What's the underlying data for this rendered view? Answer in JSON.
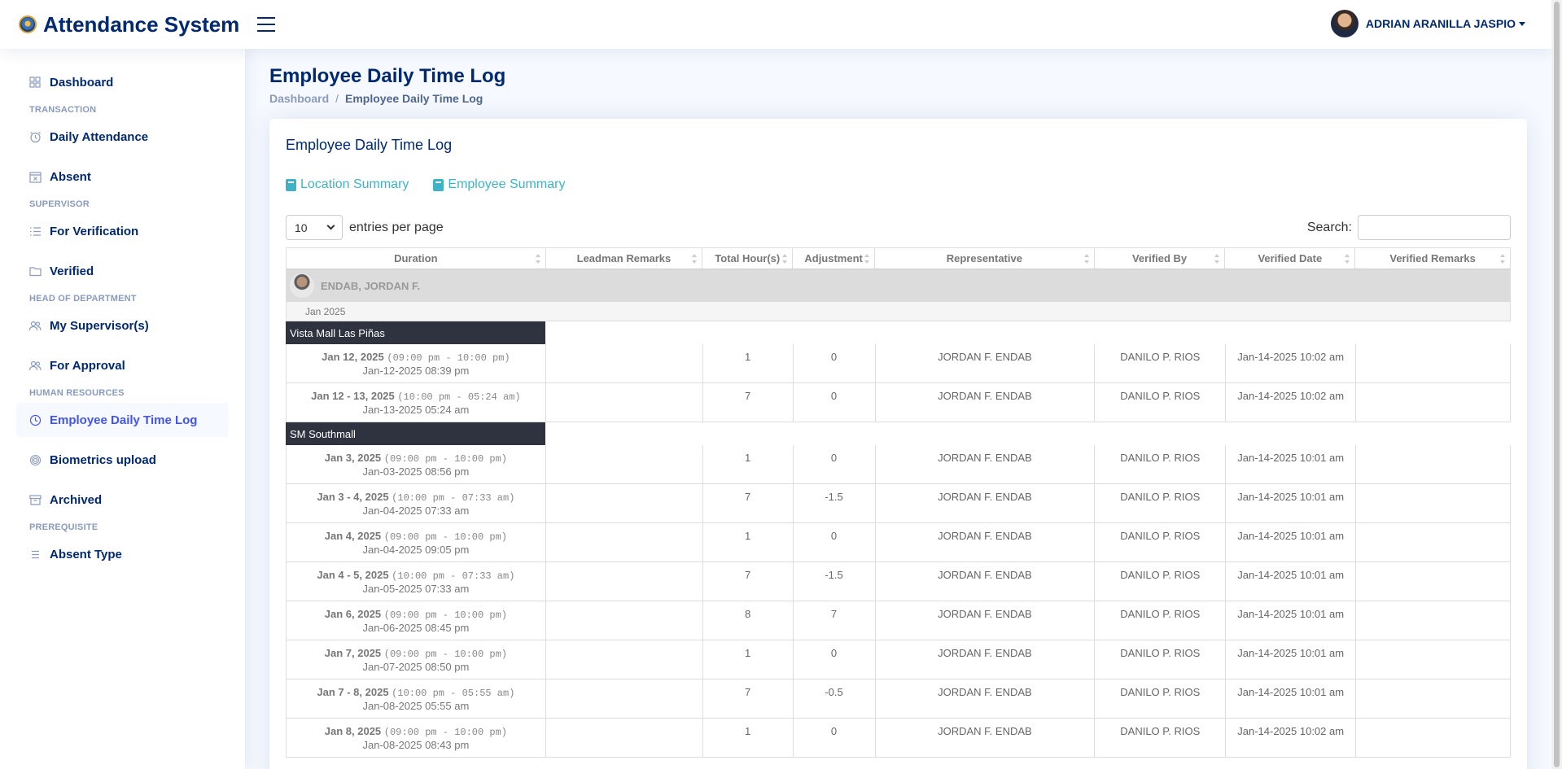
{
  "app": {
    "title": "Attendance System"
  },
  "user": {
    "name": "ADRIAN ARANILLA JASPIO"
  },
  "sidebar": {
    "items": [
      {
        "label": "Dashboard"
      },
      {
        "heading": "TRANSACTION"
      },
      {
        "label": "Daily Attendance"
      },
      {
        "label": "Absent"
      },
      {
        "heading": "SUPERVISOR"
      },
      {
        "label": "For Verification"
      },
      {
        "label": "Verified"
      },
      {
        "heading": "HEAD OF DEPARTMENT"
      },
      {
        "label": "My Supervisor(s)"
      },
      {
        "label": "For Approval"
      },
      {
        "heading": "HUMAN RESOURCES"
      },
      {
        "label": "Employee Daily Time Log"
      },
      {
        "label": "Biometrics upload"
      },
      {
        "label": "Archived"
      },
      {
        "heading": "PREREQUISITE"
      },
      {
        "label": "Absent Type"
      }
    ]
  },
  "page": {
    "title": "Employee Daily Time Log",
    "breadcrumb": [
      "Dashboard",
      "/",
      "Employee Daily Time Log"
    ]
  },
  "card": {
    "title": "Employee Daily Time Log",
    "links": [
      "Location Summary",
      "Employee Summary"
    ],
    "entries": {
      "value": "10",
      "label": "entries per page"
    },
    "search_label": "Search:"
  },
  "table": {
    "columns": [
      "Duration",
      "Leadman Remarks",
      "Total Hour(s)",
      "Adjustment",
      "Representative",
      "Verified By",
      "Verified Date",
      "Verified Remarks"
    ],
    "employee": "ENDAB, JORDAN F.",
    "month": "Jan 2025",
    "groups": [
      {
        "location": "Vista Mall Las Piñas",
        "rows": [
          {
            "date": "Jan 12, 2025",
            "time": "(09:00 pm - 10:00 pm)",
            "sub": "Jan-12-2025 08:39 pm",
            "remarks": "",
            "hours": "1",
            "adj": "0",
            "rep": "JORDAN F. ENDAB",
            "by": "DANILO P. RIOS",
            "vdate": "Jan-14-2025 10:02 am",
            "vremarks": ""
          },
          {
            "date": "Jan 12 - 13, 2025",
            "time": "(10:00 pm - 05:24 am)",
            "sub": "Jan-13-2025 05:24 am",
            "remarks": "",
            "hours": "7",
            "adj": "0",
            "rep": "JORDAN F. ENDAB",
            "by": "DANILO P. RIOS",
            "vdate": "Jan-14-2025 10:02 am",
            "vremarks": ""
          }
        ]
      },
      {
        "location": "SM Southmall",
        "rows": [
          {
            "date": "Jan 3, 2025",
            "time": "(09:00 pm - 10:00 pm)",
            "sub": "Jan-03-2025 08:56 pm",
            "remarks": "",
            "hours": "1",
            "adj": "0",
            "rep": "JORDAN F. ENDAB",
            "by": "DANILO P. RIOS",
            "vdate": "Jan-14-2025 10:01 am",
            "vremarks": ""
          },
          {
            "date": "Jan 3 - 4, 2025",
            "time": "(10:00 pm - 07:33 am)",
            "sub": "Jan-04-2025 07:33 am",
            "remarks": "",
            "hours": "7",
            "adj": "-1.5",
            "rep": "JORDAN F. ENDAB",
            "by": "DANILO P. RIOS",
            "vdate": "Jan-14-2025 10:01 am",
            "vremarks": ""
          },
          {
            "date": "Jan 4, 2025",
            "time": "(09:00 pm - 10:00 pm)",
            "sub": "Jan-04-2025 09:05 pm",
            "remarks": "",
            "hours": "1",
            "adj": "0",
            "rep": "JORDAN F. ENDAB",
            "by": "DANILO P. RIOS",
            "vdate": "Jan-14-2025 10:01 am",
            "vremarks": ""
          },
          {
            "date": "Jan 4 - 5, 2025",
            "time": "(10:00 pm - 07:33 am)",
            "sub": "Jan-05-2025 07:33 am",
            "remarks": "",
            "hours": "7",
            "adj": "-1.5",
            "rep": "JORDAN F. ENDAB",
            "by": "DANILO P. RIOS",
            "vdate": "Jan-14-2025 10:01 am",
            "vremarks": ""
          },
          {
            "date": "Jan 6, 2025",
            "time": "(09:00 pm - 10:00 pm)",
            "sub": "Jan-06-2025 08:45 pm",
            "remarks": "",
            "hours": "8",
            "adj": "7",
            "rep": "JORDAN F. ENDAB",
            "by": "DANILO P. RIOS",
            "vdate": "Jan-14-2025 10:01 am",
            "vremarks": ""
          },
          {
            "date": "Jan 7, 2025",
            "time": "(09:00 pm - 10:00 pm)",
            "sub": "Jan-07-2025 08:50 pm",
            "remarks": "",
            "hours": "1",
            "adj": "0",
            "rep": "JORDAN F. ENDAB",
            "by": "DANILO P. RIOS",
            "vdate": "Jan-14-2025 10:01 am",
            "vremarks": ""
          },
          {
            "date": "Jan 7 - 8, 2025",
            "time": "(10:00 pm - 05:55 am)",
            "sub": "Jan-08-2025 05:55 am",
            "remarks": "",
            "hours": "7",
            "adj": "-0.5",
            "rep": "JORDAN F. ENDAB",
            "by": "DANILO P. RIOS",
            "vdate": "Jan-14-2025 10:01 am",
            "vremarks": ""
          },
          {
            "date": "Jan 8, 2025",
            "time": "(09:00 pm - 10:00 pm)",
            "sub": "Jan-08-2025 08:43 pm",
            "remarks": "",
            "hours": "1",
            "adj": "0",
            "rep": "JORDAN F. ENDAB",
            "by": "DANILO P. RIOS",
            "vdate": "Jan-14-2025 10:02 am",
            "vremarks": ""
          }
        ]
      }
    ]
  },
  "icons": [
    "grid-icon",
    "alarm-clock-icon",
    "calendar-x-icon",
    "list-check-icon",
    "folder-check-icon",
    "people-icon",
    "clock-history-icon",
    "fingerprint-icon",
    "archive-icon",
    "list-icon",
    "book-icon"
  ]
}
